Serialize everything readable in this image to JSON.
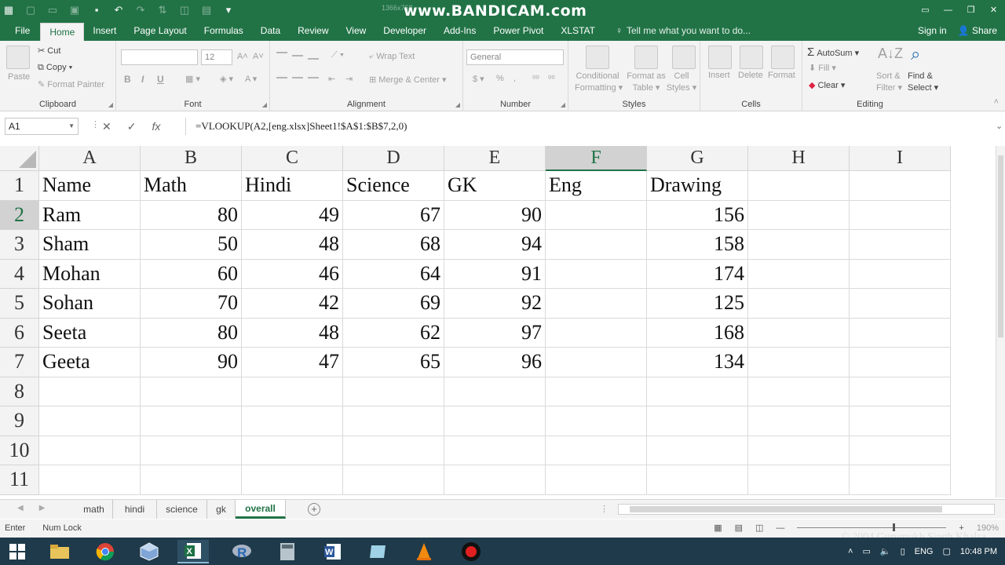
{
  "app": {
    "watermark": "www.BANDICAM.com",
    "watermark_small": "1366x768"
  },
  "ribbon_tabs": [
    "File",
    "Home",
    "Insert",
    "Page Layout",
    "Formulas",
    "Data",
    "Review",
    "View",
    "Developer",
    "Add-Ins",
    "Power Pivot",
    "XLSTAT"
  ],
  "active_tab": "Home",
  "tell_me": "Tell me what you want to do...",
  "sign_in": "Sign in",
  "share": "Share",
  "clipboard": {
    "paste": "Paste",
    "cut": "Cut",
    "copy": "Copy",
    "format_painter": "Format Painter",
    "label": "Clipboard"
  },
  "font": {
    "size": "12",
    "label": "Font"
  },
  "alignment": {
    "wrap_text": "Wrap Text",
    "merge_center": "Merge & Center",
    "label": "Alignment"
  },
  "number": {
    "format": "General",
    "label": "Number"
  },
  "styles": {
    "conditional": "Conditional",
    "conditional2": "Formatting",
    "format_as": "Format as",
    "format_as2": "Table",
    "cell": "Cell",
    "cell2": "Styles",
    "label": "Styles"
  },
  "cells": {
    "insert": "Insert",
    "delete": "Delete",
    "format": "Format",
    "label": "Cells"
  },
  "editing": {
    "autosum": "AutoSum",
    "fill": "Fill",
    "clear": "Clear",
    "sort": "Sort &",
    "sort2": "Filter",
    "find": "Find &",
    "find2": "Select",
    "label": "Editing"
  },
  "formula_bar": {
    "name_box": "A1",
    "formula": "=VLOOKUP(A2,[eng.xlsx]Sheet1!$A$1:$B$7,2,0)"
  },
  "columns": [
    "A",
    "B",
    "C",
    "D",
    "E",
    "F",
    "G",
    "H",
    "I"
  ],
  "rows": [
    "1",
    "2",
    "3",
    "4",
    "5",
    "6",
    "7",
    "8",
    "9",
    "10",
    "11"
  ],
  "sheet": {
    "headers": [
      "Name",
      "Math",
      "Hindi",
      "Science",
      "GK",
      "Eng",
      "Drawing"
    ],
    "data": [
      [
        "Ram",
        "80",
        "49",
        "67",
        "90",
        "",
        "156"
      ],
      [
        "Sham",
        "50",
        "48",
        "68",
        "94",
        "",
        "158"
      ],
      [
        "Mohan",
        "60",
        "46",
        "64",
        "91",
        "",
        "174"
      ],
      [
        "Sohan",
        "70",
        "42",
        "69",
        "92",
        "",
        "125"
      ],
      [
        "Seeta",
        "80",
        "48",
        "62",
        "97",
        "",
        "168"
      ],
      [
        "Geeta",
        "90",
        "47",
        "65",
        "96",
        "",
        "134"
      ]
    ]
  },
  "sheet_tabs": [
    "math",
    "hindi",
    "science",
    "gk",
    "overall"
  ],
  "active_sheet": "overall",
  "status": {
    "mode": "Enter",
    "num_lock": "Num Lock",
    "zoom": "190%"
  },
  "taskbar": {
    "lang": "ENG",
    "time": "10:48 PM"
  },
  "copyright": "© 2004 Gurumukh Singh Khalsa"
}
